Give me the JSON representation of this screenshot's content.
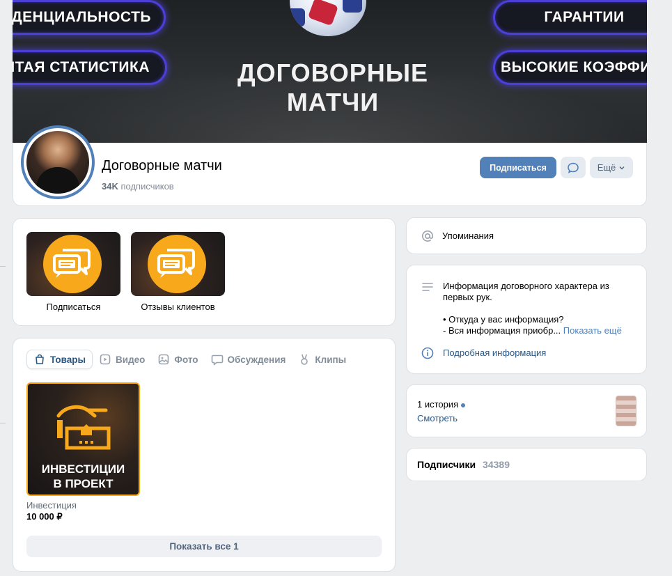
{
  "cover": {
    "left_pills": [
      "КОНФИДЕНЦИАЛЬНОСТЬ",
      "ОТКРЫТАЯ СТАТИСТИКА"
    ],
    "right_pills": [
      "ГАРАНТИИ",
      "ВЫСОКИЕ КОЭФФИЦИЕНТЫ"
    ],
    "title": "ДОГОВОРНЫЕ МАТЧИ"
  },
  "group": {
    "name": "Договорные матчи",
    "subscribers_count": "34K",
    "subscribers_label": "подписчиков",
    "subscribe_button": "Подписаться",
    "more_button": "Ещё"
  },
  "apps": [
    {
      "label": "Подписаться",
      "icon": "chat-bubbles-icon"
    },
    {
      "label": "Отзывы клиентов",
      "icon": "chat-bubbles-icon"
    }
  ],
  "tabs": [
    {
      "label": "Товары",
      "icon": "bag-icon",
      "active": true
    },
    {
      "label": "Видео",
      "icon": "video-icon",
      "active": false
    },
    {
      "label": "Фото",
      "icon": "photo-icon",
      "active": false
    },
    {
      "label": "Обсуждения",
      "icon": "discussion-icon",
      "active": false
    },
    {
      "label": "Клипы",
      "icon": "clips-icon",
      "active": false
    }
  ],
  "product": {
    "image_text_1": "ИНВЕСТИЦИИ",
    "image_text_2": "В ПРОЕКТ",
    "name": "Инвестиция",
    "price": "10 000 ₽",
    "show_all": "Показать все 1"
  },
  "sidebar": {
    "mentions": "Упоминания",
    "info_line1": "Информация договорного характера из",
    "info_line2": "первых рук.",
    "info_line3": "• Откуда у вас информация?",
    "info_line4": "- Вся информация приобр...",
    "show_more": "Показать ещё",
    "detailed_info": "Подробная информация",
    "stories_count": "1 история",
    "stories_watch": "Смотреть",
    "followers_label": "Подписчики",
    "followers_count": "34389"
  },
  "colors": {
    "accent": "#5181b8",
    "link": "#2a5885",
    "brand_orange": "#f7a81b",
    "neon_border": "#4b3fd8",
    "page_bg": "#edeef0"
  }
}
